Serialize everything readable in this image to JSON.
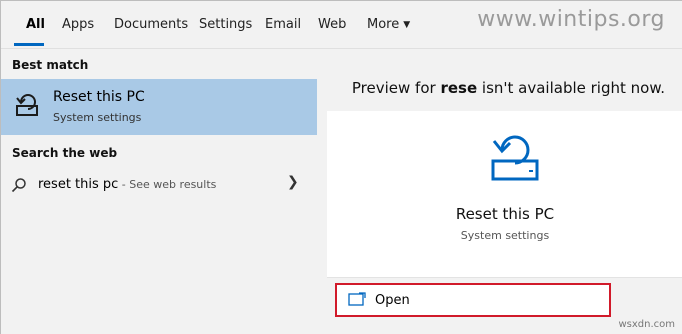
{
  "tabs": [
    {
      "label": "All",
      "active": true
    },
    {
      "label": "Apps"
    },
    {
      "label": "Documents"
    },
    {
      "label": "Settings"
    },
    {
      "label": "Email"
    },
    {
      "label": "Web"
    },
    {
      "label": "More"
    }
  ],
  "watermark": "www.wintips.org",
  "best_match": {
    "heading": "Best match",
    "title": "Reset this PC",
    "subtitle": "System settings",
    "icon": "reset-pc-icon"
  },
  "search_web": {
    "heading": "Search the web",
    "query": "reset this pc",
    "hint": " - See web results",
    "icon": "search-icon"
  },
  "preview": {
    "message_prefix": "Preview for ",
    "message_term": "rese",
    "message_suffix": " isn't available right now.",
    "title": "Reset this PC",
    "subtitle": "System settings",
    "icon": "reset-pc-icon"
  },
  "actions": {
    "open_label": "Open",
    "open_icon": "open-window-icon",
    "highlight_color": "#d11a2a"
  },
  "colors": {
    "accent": "#0067c0",
    "selection": "#a9c9e6"
  },
  "site_mark": "wsxdn.com"
}
